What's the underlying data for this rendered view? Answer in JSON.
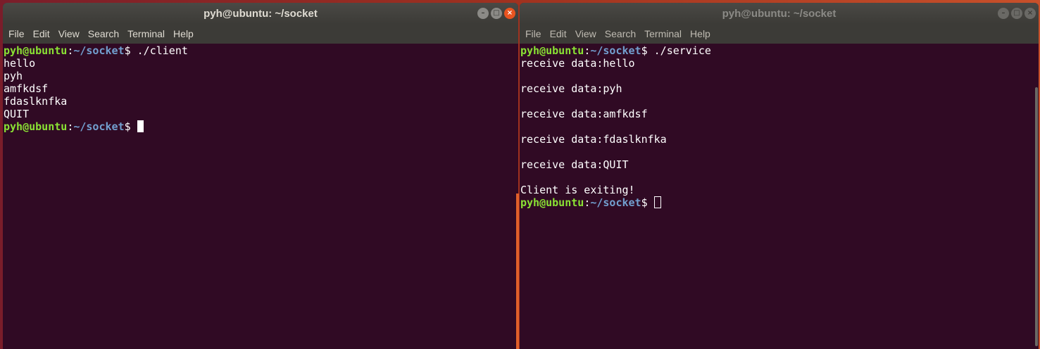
{
  "left_window": {
    "title": "pyh@ubuntu: ~/socket",
    "menu": [
      "File",
      "Edit",
      "View",
      "Search",
      "Terminal",
      "Help"
    ],
    "prompt": {
      "user": "pyh@ubuntu",
      "path": "~/socket",
      "symbol": "$"
    },
    "command": "./client",
    "output": [
      "hello",
      "pyh",
      "amfkdsf",
      "fdaslknfka",
      "QUIT"
    ]
  },
  "right_window": {
    "title": "pyh@ubuntu: ~/socket",
    "menu": [
      "File",
      "Edit",
      "View",
      "Search",
      "Terminal",
      "Help"
    ],
    "prompt": {
      "user": "pyh@ubuntu",
      "path": "~/socket",
      "symbol": "$"
    },
    "command": "./service",
    "output": [
      "receive data:hello",
      "",
      "receive data:pyh",
      "",
      "receive data:amfkdsf",
      "",
      "receive data:fdaslknfka",
      "",
      "receive data:QUIT",
      "",
      "Client is exiting!"
    ]
  },
  "window_buttons": {
    "minimize": "–",
    "maximize": "□",
    "close": "×"
  },
  "colors": {
    "terminal_bg": "#300a24",
    "prompt_user": "#8ae234",
    "prompt_path": "#729fcf",
    "close_button": "#e95420"
  }
}
